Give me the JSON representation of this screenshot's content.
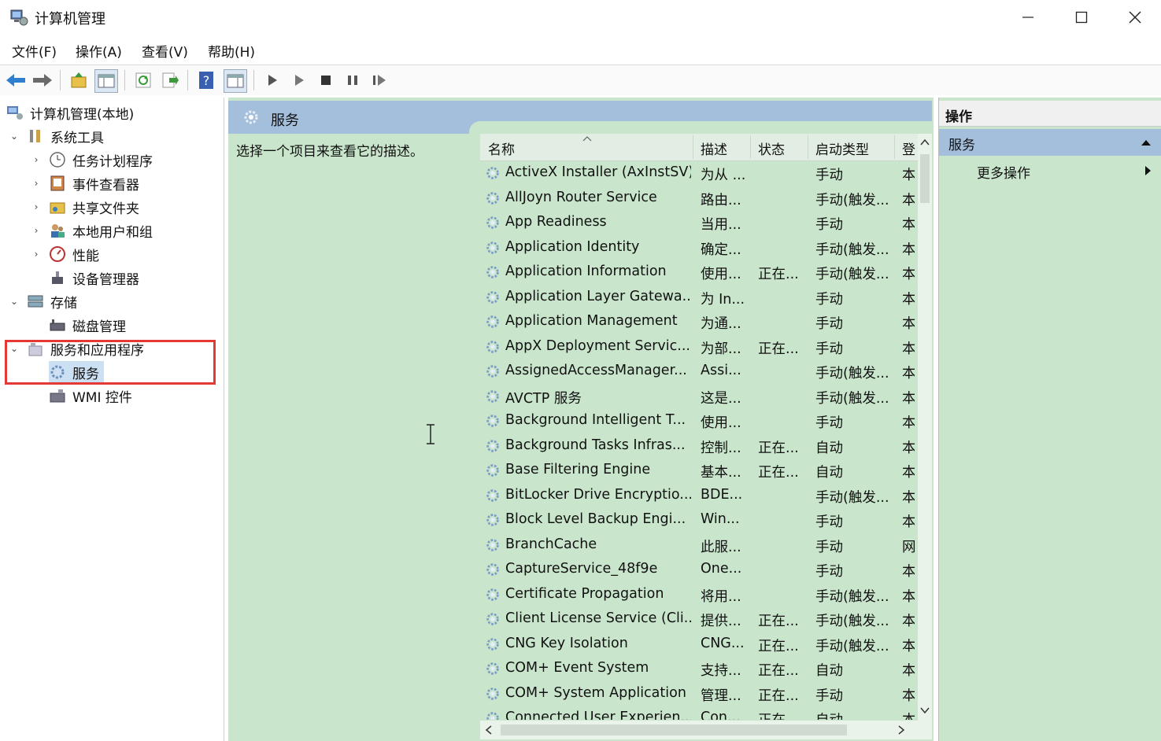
{
  "window": {
    "title": "计算机管理",
    "min": "—",
    "max": "☐",
    "close": "✕"
  },
  "menu": [
    "文件(F)",
    "操作(A)",
    "查看(V)",
    "帮助(H)"
  ],
  "tree": {
    "root": "计算机管理(本地)",
    "system_tools": "系统工具",
    "task_scheduler": "任务计划程序",
    "event_viewer": "事件查看器",
    "shared_folders": "共享文件夹",
    "local_users": "本地用户和组",
    "performance": "性能",
    "device_manager": "设备管理器",
    "storage": "存储",
    "disk_mgmt": "磁盘管理",
    "services_apps": "服务和应用程序",
    "services": "服务",
    "wmi": "WMI 控件"
  },
  "main": {
    "header": "服务",
    "description": "选择一个项目来查看它的描述。",
    "columns": [
      "名称",
      "描述",
      "状态",
      "启动类型",
      "登"
    ],
    "rows": [
      [
        "ActiveX Installer (AxInstSV)",
        "为从 ...",
        "",
        "手动",
        "本"
      ],
      [
        "AllJoyn Router Service",
        "路由...",
        "",
        "手动(触发...",
        "本"
      ],
      [
        "App Readiness",
        "当用...",
        "",
        "手动",
        "本"
      ],
      [
        "Application Identity",
        "确定...",
        "",
        "手动(触发...",
        "本"
      ],
      [
        "Application Information",
        "使用...",
        "正在...",
        "手动(触发...",
        "本"
      ],
      [
        "Application Layer Gatewa...",
        "为 In...",
        "",
        "手动",
        "本"
      ],
      [
        "Application Management",
        "为通...",
        "",
        "手动",
        "本"
      ],
      [
        "AppX Deployment Servic...",
        "为部...",
        "正在...",
        "手动",
        "本"
      ],
      [
        "AssignedAccessManager...",
        "Assi...",
        "",
        "手动(触发...",
        "本"
      ],
      [
        "AVCTP 服务",
        "这是...",
        "",
        "手动(触发...",
        "本"
      ],
      [
        "Background Intelligent T...",
        "使用...",
        "",
        "手动",
        "本"
      ],
      [
        "Background Tasks Infras...",
        "控制...",
        "正在...",
        "自动",
        "本"
      ],
      [
        "Base Filtering Engine",
        "基本...",
        "正在...",
        "自动",
        "本"
      ],
      [
        "BitLocker Drive Encryptio...",
        "BDE...",
        "",
        "手动(触发...",
        "本"
      ],
      [
        "Block Level Backup Engi...",
        "Win...",
        "",
        "手动",
        "本"
      ],
      [
        "BranchCache",
        "此服...",
        "",
        "手动",
        "网"
      ],
      [
        "CaptureService_48f9e",
        "One...",
        "",
        "手动",
        "本"
      ],
      [
        "Certificate Propagation",
        "将用...",
        "",
        "手动(触发...",
        "本"
      ],
      [
        "Client License Service (Cli...",
        "提供...",
        "正在...",
        "手动(触发...",
        "本"
      ],
      [
        "CNG Key Isolation",
        "CNG...",
        "正在...",
        "手动(触发...",
        "本"
      ],
      [
        "COM+ Event System",
        "支持...",
        "正在...",
        "自动",
        "本"
      ],
      [
        "COM+ System Application",
        "管理...",
        "正在...",
        "手动",
        "本"
      ],
      [
        "Connected User Experien...",
        "Con...",
        "正在...",
        "自动",
        "本"
      ]
    ]
  },
  "actions": {
    "header": "操作",
    "section": "服务",
    "more": "更多操作"
  },
  "colors": {
    "pane_bg": "#c9e6cc",
    "header_blue": "#a4bfdc",
    "highlight": "#e53935"
  }
}
